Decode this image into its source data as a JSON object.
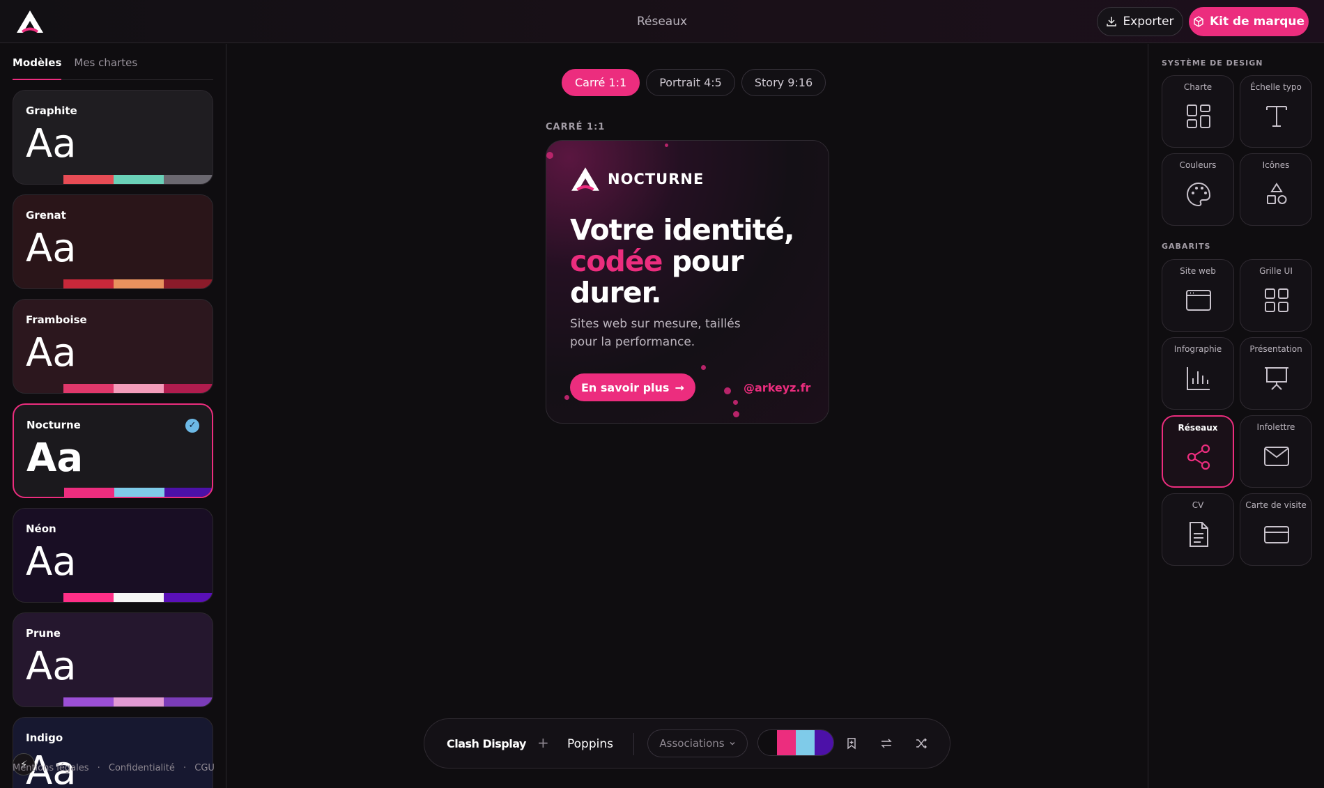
{
  "header": {
    "title": "Réseaux",
    "export_label": "Exporter",
    "kit_label": "Kit de marque"
  },
  "sidebar": {
    "tabs": [
      {
        "label": "Modèles",
        "active": true
      },
      {
        "label": "Mes chartes",
        "active": false
      }
    ],
    "themes": [
      {
        "name": "Graphite",
        "sample": "Aa",
        "bg": "#1f1d21",
        "colors": [
          "#e74c55",
          "#6ad1b8",
          "#6b6870"
        ],
        "selected": false
      },
      {
        "name": "Grenat",
        "sample": "Aa",
        "bg": "#2a1519",
        "colors": [
          "#c9283a",
          "#e8925e",
          "#8b1b2a"
        ],
        "selected": false
      },
      {
        "name": "Framboise",
        "sample": "Aa",
        "bg": "#2c171e",
        "colors": [
          "#e0386b",
          "#f39cba",
          "#b01c4e"
        ],
        "selected": false
      },
      {
        "name": "Nocturne",
        "sample": "Aa",
        "bg": "#1b191d",
        "colors": [
          "#ec2d7e",
          "#7fcbe9",
          "#4c11a8"
        ],
        "selected": true
      },
      {
        "name": "Néon",
        "sample": "Aa",
        "bg": "#190e24",
        "colors": [
          "#ff2f87",
          "#f5f5f5",
          "#5a10b8"
        ],
        "selected": false
      },
      {
        "name": "Prune",
        "sample": "Aa",
        "bg": "#25172e",
        "colors": [
          "#9b4fd6",
          "#e19ad3",
          "#7a3cb8"
        ],
        "selected": false
      },
      {
        "name": "Indigo",
        "sample": "Aa",
        "bg": "#171830",
        "colors": [
          "#4d4df0",
          "#9b9bf0",
          "#2a2aa0"
        ],
        "selected": false
      }
    ],
    "footer": {
      "legal": "Mentions légales",
      "privacy": "Confidentialité",
      "terms": "CGU",
      "sep": "·"
    }
  },
  "canvas": {
    "formats": [
      {
        "label": "Carré 1:1",
        "active": true
      },
      {
        "label": "Portrait 4:5",
        "active": false
      },
      {
        "label": "Story 9:16",
        "active": false
      }
    ],
    "label": "CARRÉ 1:1",
    "post": {
      "brand": "NOCTURNE",
      "title_line1": "Votre identité,",
      "title_accent": "codée",
      "title_line2_rest": " pour",
      "title_line3": "durer.",
      "subtitle": "Sites web sur mesure, taillés pour la performance.",
      "cta": "En savoir plus",
      "cta_arrow": "→",
      "handle": "@arkeyz.fr"
    }
  },
  "toolbar": {
    "heading_font": "Clash Display",
    "plus": "+",
    "body_font": "Poppins",
    "associations_label": "Associations",
    "swatches": [
      "#0f0d10",
      "#ec2d7e",
      "#7fcbe9",
      "#4c11a8"
    ]
  },
  "rightbar": {
    "design_system_label": "SYSTÈME DE DESIGN",
    "design_system": [
      {
        "label": "Charte",
        "icon": "grid-icon"
      },
      {
        "label": "Échelle typo",
        "icon": "type-icon"
      },
      {
        "label": "Couleurs",
        "icon": "palette-icon"
      },
      {
        "label": "Icônes",
        "icon": "shapes-icon"
      }
    ],
    "templates_label": "GABARITS",
    "templates": [
      {
        "label": "Site web",
        "icon": "browser-icon",
        "selected": false
      },
      {
        "label": "Grille UI",
        "icon": "grid-icon",
        "selected": false
      },
      {
        "label": "Infographie",
        "icon": "chart-icon",
        "selected": false
      },
      {
        "label": "Présentation",
        "icon": "presentation-icon",
        "selected": false
      },
      {
        "label": "Réseaux",
        "icon": "share-icon",
        "selected": true
      },
      {
        "label": "Infolettre",
        "icon": "mail-icon",
        "selected": false
      },
      {
        "label": "CV",
        "icon": "document-icon",
        "selected": false
      },
      {
        "label": "Carte de visite",
        "icon": "card-icon",
        "selected": false
      }
    ]
  },
  "colors": {
    "accent": "#ec2d7e",
    "background": "#0f0d10"
  }
}
